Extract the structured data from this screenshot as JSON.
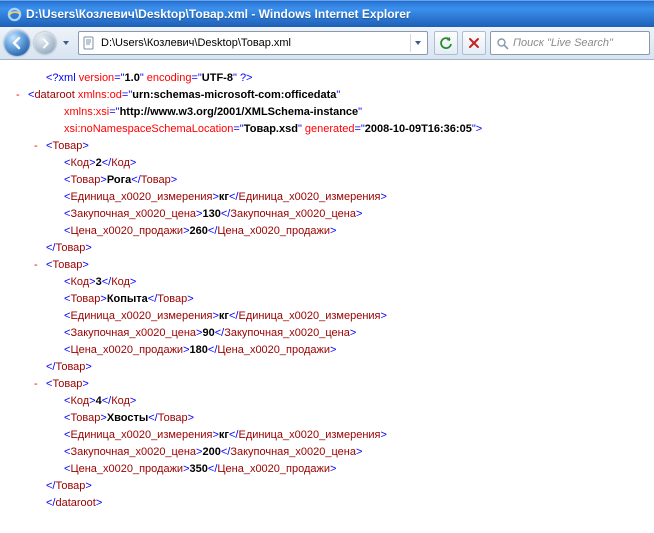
{
  "window": {
    "title": "D:\\Users\\Козлевич\\Desktop\\Товар.xml - Windows Internet Explorer",
    "address": "D:\\Users\\Козлевич\\Desktop\\Товар.xml",
    "search_placeholder": "Поиск \"Live Search\""
  },
  "xml": {
    "declaration": {
      "version": "1.0",
      "encoding": "UTF-8"
    },
    "root": {
      "tag": "dataroot",
      "xmlns_od": "urn:schemas-microsoft-com:officedata",
      "xmlns_xsi": "http://www.w3.org/2001/XMLSchema-instance",
      "nons_loc": "Товар.xsd",
      "generated": "2008-10-09T16:36:05"
    },
    "items": [
      {
        "code": "2",
        "name": "Рога",
        "unit": "кг",
        "buy": "130",
        "sell": "260"
      },
      {
        "code": "3",
        "name": "Копыта",
        "unit": "кг",
        "buy": "90",
        "sell": "180"
      },
      {
        "code": "4",
        "name": "Хвосты",
        "unit": "кг",
        "buy": "200",
        "sell": "350"
      }
    ],
    "tags": {
      "item": "Товар",
      "code": "Код",
      "name_field": "Товар",
      "unit": "Единица_x0020_измерения",
      "buy": "Закупочная_x0020_цена",
      "sell": "Цена_x0020_продажи"
    },
    "attr_labels": {
      "xmlns_od": "xmlns:od",
      "xmlns_xsi": "xmlns:xsi",
      "nons_loc": "xsi:noNamespaceSchemaLocation",
      "generated": "generated",
      "version": "version",
      "encoding": "encoding"
    }
  }
}
